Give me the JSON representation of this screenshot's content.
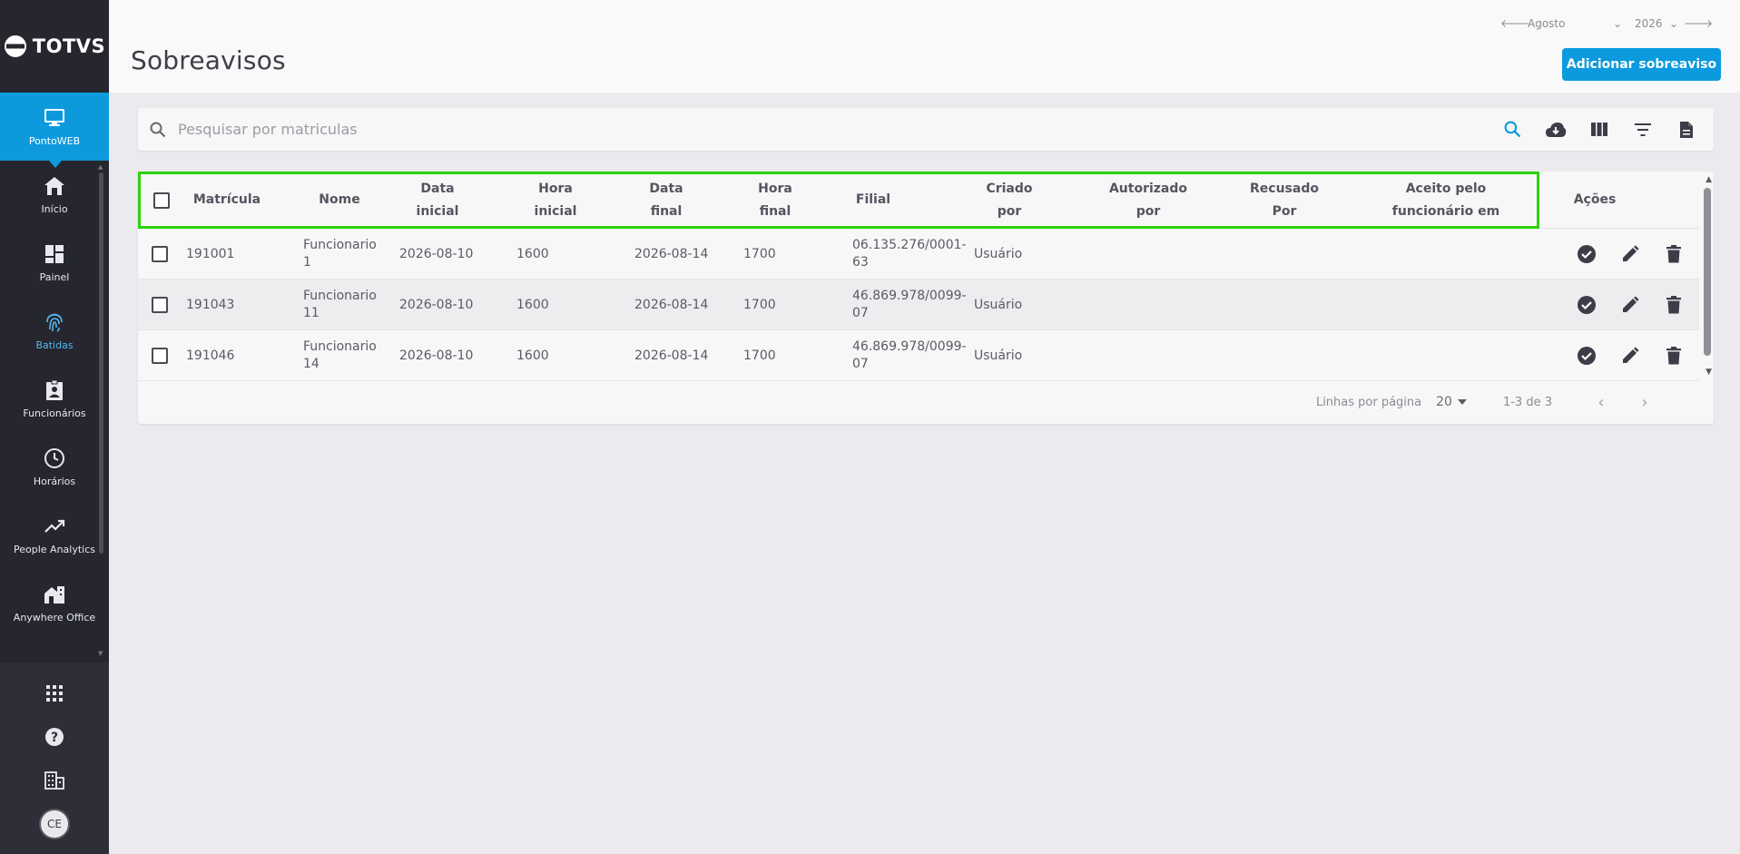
{
  "app": {
    "logo_text": "TOTVS"
  },
  "sidebar": {
    "items": [
      {
        "label": "PontoWEB"
      },
      {
        "label": "Início"
      },
      {
        "label": "Painel"
      },
      {
        "label": "Batidas"
      },
      {
        "label": "Funcionários"
      },
      {
        "label": "Horários"
      },
      {
        "label": "People Analytics"
      },
      {
        "label": "Anywhere Office"
      }
    ],
    "avatar": "CE"
  },
  "header": {
    "title": "Sobreavisos",
    "month": "Agosto",
    "year": "2026",
    "add_button": "Adicionar sobreaviso"
  },
  "search": {
    "placeholder": "Pesquisar por matriculas"
  },
  "table": {
    "columns": {
      "matricula": "Matrícula",
      "nome": "Nome",
      "data_inicial_1": "Data",
      "data_inicial_2": "inicial",
      "hora_inicial_1": "Hora",
      "hora_inicial_2": "inicial",
      "data_final_1": "Data",
      "data_final_2": "final",
      "hora_final_1": "Hora",
      "hora_final_2": "final",
      "filial": "Filial",
      "criado_1": "Criado",
      "criado_2": "por",
      "autorizado_1": "Autorizado",
      "autorizado_2": "por",
      "recusado_1": "Recusado",
      "recusado_2": "Por",
      "aceito_1": "Aceito pelo",
      "aceito_2": "funcionário em",
      "acoes": "Ações"
    },
    "rows": [
      {
        "matricula": "191001",
        "nome_1": "Funcionario 1",
        "nome_2": "",
        "data_inicial": "2026-08-10",
        "hora_inicial": "1600",
        "data_final": "2026-08-14",
        "hora_final": "1700",
        "filial_1": "06.135.276/0001-",
        "filial_2": "63",
        "criado": "Usuário"
      },
      {
        "matricula": "191043",
        "nome_1": "Funcionario",
        "nome_2": "11",
        "data_inicial": "2026-08-10",
        "hora_inicial": "1600",
        "data_final": "2026-08-14",
        "hora_final": "1700",
        "filial_1": "46.869.978/0099-",
        "filial_2": "07",
        "criado": "Usuário"
      },
      {
        "matricula": "191046",
        "nome_1": "Funcionario",
        "nome_2": "14",
        "data_inicial": "2026-08-10",
        "hora_inicial": "1600",
        "data_final": "2026-08-14",
        "hora_final": "1700",
        "filial_1": "46.869.978/0099-",
        "filial_2": "07",
        "criado": "Usuário"
      }
    ]
  },
  "pager": {
    "rows_label": "Linhas por página",
    "rows_value": "20",
    "range": "1-3 de 3"
  },
  "colors": {
    "accent": "#0c9ade",
    "sidebar": "#25262e",
    "highlight": "#2ed10d"
  }
}
